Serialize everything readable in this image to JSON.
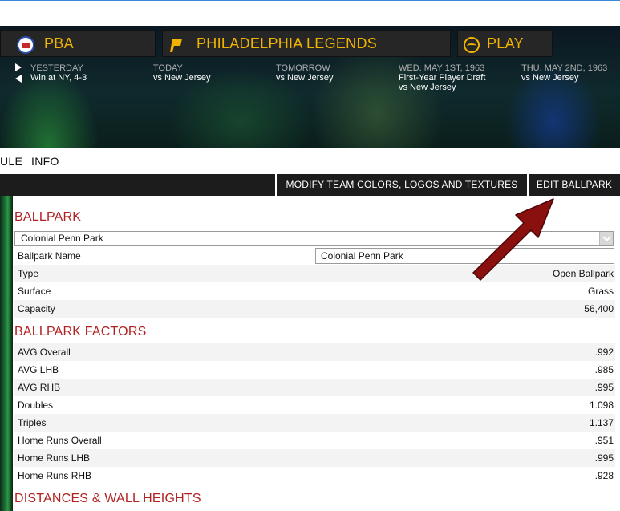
{
  "header": {
    "league": "PBA",
    "team": "PHILADELPHIA LEGENDS",
    "play": "PLAY",
    "schedule": [
      {
        "day": "YESTERDAY",
        "line1": "Win at NY, 4-3",
        "line2": ""
      },
      {
        "day": "TODAY",
        "line1": "vs New Jersey",
        "line2": ""
      },
      {
        "day": "TOMORROW",
        "line1": "vs New Jersey",
        "line2": ""
      },
      {
        "day": "WED. MAY 1ST, 1963",
        "line1": "First-Year Player Draft",
        "line2": "vs New Jersey"
      },
      {
        "day": "THU. MAY 2ND, 1963",
        "line1": "vs New Jersey",
        "line2": ""
      }
    ]
  },
  "menu": {
    "item1": "ULE",
    "item2": "INFO"
  },
  "toolbar": {
    "modify_label": "MODIFY TEAM COLORS, LOGOS AND TEXTURES",
    "edit_label": "EDIT BALLPARK"
  },
  "ballpark": {
    "title": "BALLPARK",
    "selected": "Colonial Penn Park",
    "rows": [
      {
        "label": "Ballpark Name",
        "value": "Colonial Penn Park"
      },
      {
        "label": "Type",
        "value": "Open Ballpark"
      },
      {
        "label": "Surface",
        "value": "Grass"
      },
      {
        "label": "Capacity",
        "value": "56,400"
      }
    ]
  },
  "factors": {
    "title": "BALLPARK FACTORS",
    "rows": [
      {
        "label": "AVG Overall",
        "value": ".992"
      },
      {
        "label": "AVG LHB",
        "value": ".985"
      },
      {
        "label": "AVG RHB",
        "value": ".995"
      },
      {
        "label": "Doubles",
        "value": "1.098"
      },
      {
        "label": "Triples",
        "value": "1.137"
      },
      {
        "label": "Home Runs Overall",
        "value": ".951"
      },
      {
        "label": "Home Runs LHB",
        "value": ".995"
      },
      {
        "label": "Home Runs RHB",
        "value": ".928"
      }
    ]
  },
  "distances": {
    "title": "DISTANCES & WALL HEIGHTS"
  },
  "colors": {
    "accent_red": "#b02222",
    "gold": "#f0b400",
    "arrow": "#8a1010"
  }
}
